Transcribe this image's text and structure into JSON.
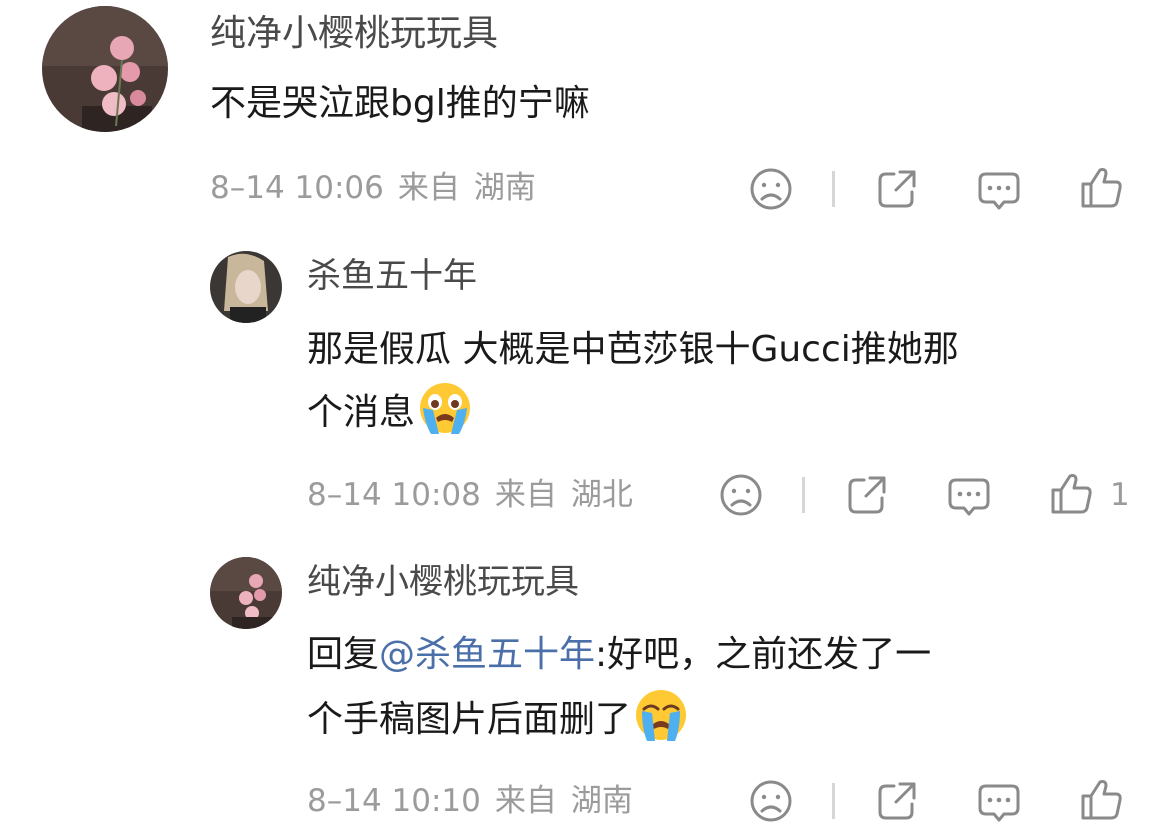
{
  "comments": [
    {
      "username": "纯净小樱桃玩玩具",
      "text": "不是哭泣跟bgl推的宁嘛",
      "date": "8–14 10:06",
      "source": "来自",
      "location": "湖南",
      "likes": ""
    },
    {
      "username": "杀鱼五十年",
      "text_line1": "那是假瓜 大概是中芭莎银十Gucci推她那",
      "text_line2": "个消息",
      "date": "8–14 10:08",
      "source": "来自",
      "location": "湖北",
      "likes": "1"
    },
    {
      "username": "纯净小樱桃玩玩具",
      "reply_prefix": "回复",
      "mention": "@杀鱼五十年",
      "text_line1_rest": ":好吧，之前还发了一",
      "text_line2": "个手稿图片后面删了",
      "date": "8–14 10:10",
      "source": "来自",
      "location": "湖南",
      "likes": ""
    }
  ],
  "icons": [
    "sad-face-icon",
    "share-icon",
    "comment-icon",
    "thumbs-up-icon",
    "crying-emoji-icon"
  ]
}
